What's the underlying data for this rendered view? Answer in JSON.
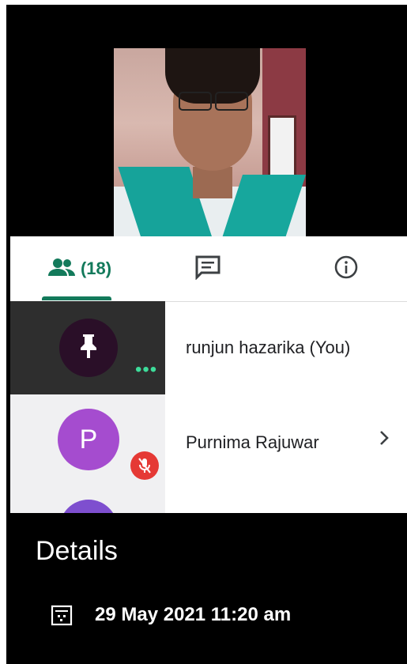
{
  "tabs": [
    {
      "name": "people",
      "icon": "people-icon",
      "label": "(18)",
      "active": true
    },
    {
      "name": "chat",
      "icon": "chat-icon"
    },
    {
      "name": "info",
      "icon": "info-icon"
    }
  ],
  "participants": [
    {
      "name": "runjun hazarika (You)",
      "avatar_icon": "pin-icon",
      "status": "more-dots-icon"
    },
    {
      "name": "Purnima Rajuwar",
      "avatar_letter": "P",
      "status": "mic-off-icon"
    }
  ],
  "details": {
    "title": "Details",
    "datetime": "29 May 2021 11:20 am"
  },
  "colors": {
    "accent": "#137a5b",
    "mic_off": "#e53935",
    "avatar_p": "#a54ccf"
  }
}
